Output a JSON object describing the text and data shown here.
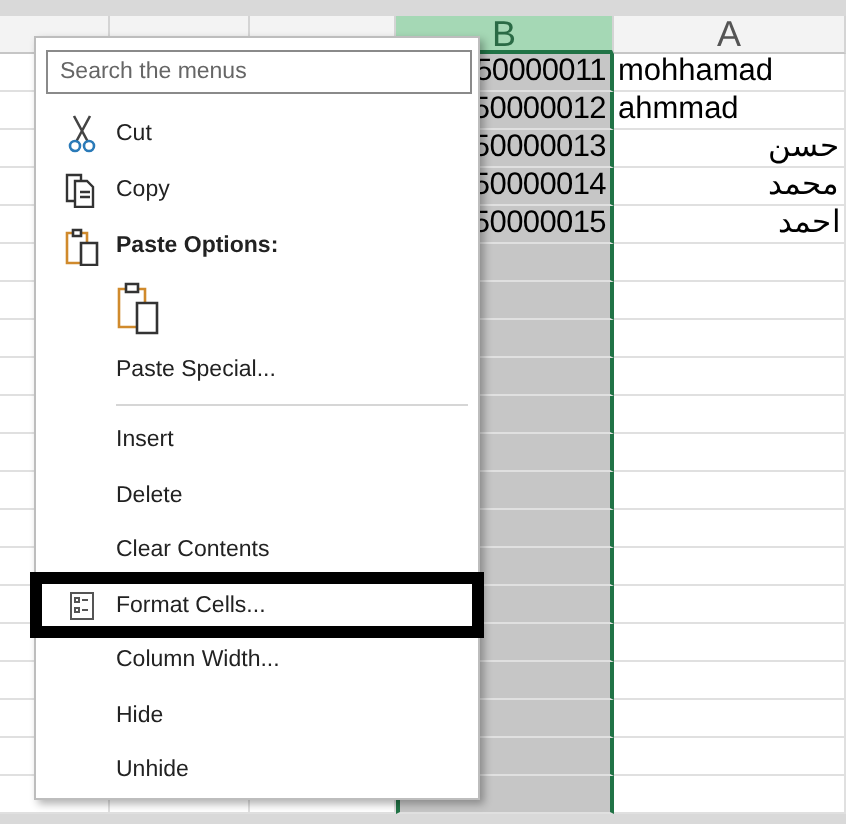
{
  "sheet": {
    "columns": [
      {
        "selected": false
      },
      {
        "selected": false
      },
      {
        "selected": false
      },
      {
        "label": "B",
        "selected": true
      },
      {
        "label": "A",
        "selected": false
      }
    ],
    "rows": [
      {
        "column_b": "50000011",
        "column_a": "mohhamad"
      },
      {
        "column_b": "50000012",
        "column_a": "ahmmad"
      },
      {
        "column_b": "50000013",
        "column_a": "حسن"
      },
      {
        "column_b": "50000014",
        "column_a": "محمد"
      },
      {
        "column_b": "50000015",
        "column_a": "احمد"
      }
    ]
  },
  "context_menu": {
    "search": {
      "placeholder": "Search the menus"
    },
    "items": [
      {
        "kind": "cut-item",
        "label": "Cut",
        "highlighted": false
      },
      {
        "kind": "copy-item",
        "label": "Copy",
        "highlighted": false
      },
      {
        "kind": "paste-header",
        "label": "Paste Options:"
      },
      {
        "kind": "paste-option"
      },
      {
        "kind": "item",
        "label": "Paste Special...",
        "highlighted": false
      },
      {
        "kind": "separator"
      },
      {
        "kind": "item",
        "label": "Insert",
        "highlighted": false
      },
      {
        "kind": "item",
        "label": "Delete",
        "highlighted": false
      },
      {
        "kind": "item",
        "label": "Clear Contents",
        "highlighted": false
      },
      {
        "kind": "format-item",
        "label": "Format Cells...",
        "highlighted": true
      },
      {
        "kind": "item",
        "label": "Column Width...",
        "highlighted": false
      },
      {
        "kind": "item",
        "label": "Hide",
        "highlighted": false
      },
      {
        "kind": "item",
        "label": "Unhide",
        "highlighted": false
      }
    ]
  }
}
